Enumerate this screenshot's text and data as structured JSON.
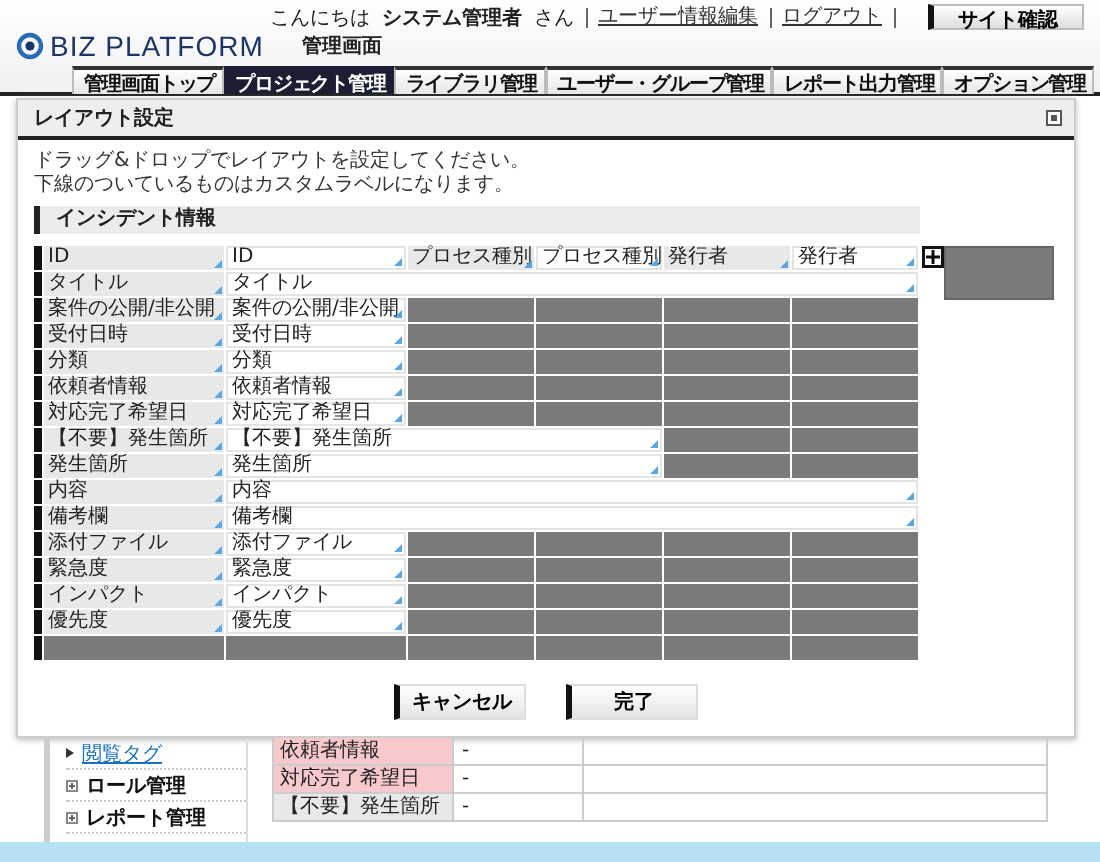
{
  "header": {
    "logo": "BIZ PLATFORM",
    "subtitle": "管理画面",
    "greeting": "こんにちは",
    "user": "システム管理者",
    "honorific": "さん",
    "links": [
      "ユーザー情報編集",
      "ログアウト"
    ],
    "site_button": "サイト確認"
  },
  "tabs": [
    {
      "label": "管理画面トップ",
      "selected": false
    },
    {
      "label": "プロジェクト管理",
      "selected": true
    },
    {
      "label": "ライブラリ管理",
      "selected": false
    },
    {
      "label": "ユーザー・グループ管理",
      "selected": false
    },
    {
      "label": "レポート出力管理",
      "selected": false
    },
    {
      "label": "オプション管理",
      "selected": false
    }
  ],
  "dialog": {
    "title": "レイアウト設定",
    "description": [
      "ドラッグ&ドロップでレイアウトを設定してください。",
      "下線のついているものはカスタムラベルになります。"
    ],
    "section": "インシデント情報",
    "rows": [
      {
        "cells": [
          {
            "kind": "label",
            "text": "ID"
          },
          {
            "kind": "value",
            "text": "ID"
          },
          {
            "kind": "label",
            "text": "プロセス種別"
          },
          {
            "kind": "value",
            "text": "プロセス種別"
          },
          {
            "kind": "label",
            "text": "発行者"
          },
          {
            "kind": "value",
            "text": "発行者"
          }
        ]
      },
      {
        "cells": [
          {
            "kind": "label",
            "text": "タイトル"
          },
          {
            "kind": "value",
            "text": "タイトル"
          }
        ]
      },
      {
        "cells": [
          {
            "kind": "label",
            "text": "案件の公開/非公開"
          },
          {
            "kind": "value",
            "text": "案件の公開/非公開"
          },
          {
            "kind": "empty"
          },
          {
            "kind": "empty"
          },
          {
            "kind": "empty"
          },
          {
            "kind": "empty"
          }
        ]
      },
      {
        "cells": [
          {
            "kind": "label",
            "text": "受付日時"
          },
          {
            "kind": "value",
            "text": "受付日時"
          },
          {
            "kind": "empty"
          },
          {
            "kind": "empty"
          },
          {
            "kind": "empty"
          },
          {
            "kind": "empty"
          }
        ]
      },
      {
        "cells": [
          {
            "kind": "label",
            "text": "分類"
          },
          {
            "kind": "value",
            "text": "分類"
          },
          {
            "kind": "empty"
          },
          {
            "kind": "empty"
          },
          {
            "kind": "empty"
          },
          {
            "kind": "empty"
          }
        ]
      },
      {
        "cells": [
          {
            "kind": "label",
            "text": "依頼者情報"
          },
          {
            "kind": "value",
            "text": "依頼者情報"
          },
          {
            "kind": "empty"
          },
          {
            "kind": "empty"
          },
          {
            "kind": "empty"
          },
          {
            "kind": "empty"
          }
        ]
      },
      {
        "cells": [
          {
            "kind": "label",
            "text": "対応完了希望日"
          },
          {
            "kind": "value",
            "text": "対応完了希望日"
          },
          {
            "kind": "empty"
          },
          {
            "kind": "empty"
          },
          {
            "kind": "empty"
          },
          {
            "kind": "empty"
          }
        ]
      },
      {
        "cells": [
          {
            "kind": "label",
            "text": "【不要】発生箇所"
          },
          {
            "kind": "value",
            "text": "【不要】発生箇所"
          },
          {
            "kind": "empty"
          },
          {
            "kind": "empty"
          }
        ]
      },
      {
        "cells": [
          {
            "kind": "label",
            "text": "発生箇所"
          },
          {
            "kind": "value",
            "text": "発生箇所"
          },
          {
            "kind": "empty"
          },
          {
            "kind": "empty"
          }
        ]
      },
      {
        "cells": [
          {
            "kind": "label",
            "text": "内容"
          },
          {
            "kind": "value",
            "text": "内容"
          }
        ]
      },
      {
        "cells": [
          {
            "kind": "label",
            "text": "備考欄"
          },
          {
            "kind": "value",
            "text": "備考欄"
          }
        ]
      },
      {
        "cells": [
          {
            "kind": "label",
            "text": "添付ファイル"
          },
          {
            "kind": "value",
            "text": "添付ファイル"
          },
          {
            "kind": "empty"
          },
          {
            "kind": "empty"
          },
          {
            "kind": "empty"
          },
          {
            "kind": "empty"
          }
        ]
      },
      {
        "cells": [
          {
            "kind": "label",
            "text": "緊急度"
          },
          {
            "kind": "value",
            "text": "緊急度"
          },
          {
            "kind": "empty"
          },
          {
            "kind": "empty"
          },
          {
            "kind": "empty"
          },
          {
            "kind": "empty"
          }
        ]
      },
      {
        "cells": [
          {
            "kind": "label",
            "text": "インパクト"
          },
          {
            "kind": "value",
            "text": "インパクト"
          },
          {
            "kind": "empty"
          },
          {
            "kind": "empty"
          },
          {
            "kind": "empty"
          },
          {
            "kind": "empty"
          }
        ]
      },
      {
        "cells": [
          {
            "kind": "label",
            "text": "優先度"
          },
          {
            "kind": "value",
            "text": "優先度"
          },
          {
            "kind": "empty"
          },
          {
            "kind": "empty"
          },
          {
            "kind": "empty"
          },
          {
            "kind": "empty"
          }
        ]
      },
      {
        "cells": [
          {
            "kind": "empty"
          },
          {
            "kind": "empty"
          },
          {
            "kind": "empty"
          },
          {
            "kind": "empty"
          },
          {
            "kind": "empty"
          },
          {
            "kind": "empty"
          }
        ]
      }
    ],
    "buttons": [
      "キャンセル",
      "完了"
    ]
  },
  "sidebar": {
    "items": [
      {
        "kind": "link",
        "text": "閲覧タグ"
      },
      {
        "kind": "group",
        "text": "ロール管理"
      },
      {
        "kind": "group",
        "text": "レポート管理"
      }
    ]
  },
  "detail_table": {
    "rows": [
      {
        "label": "依頼者情報",
        "value": "-",
        "highlighted": true
      },
      {
        "label": "対応完了希望日",
        "value": "-",
        "highlighted": true
      },
      {
        "label": "【不要】発生箇所",
        "value": "-",
        "highlighted": false
      }
    ]
  }
}
